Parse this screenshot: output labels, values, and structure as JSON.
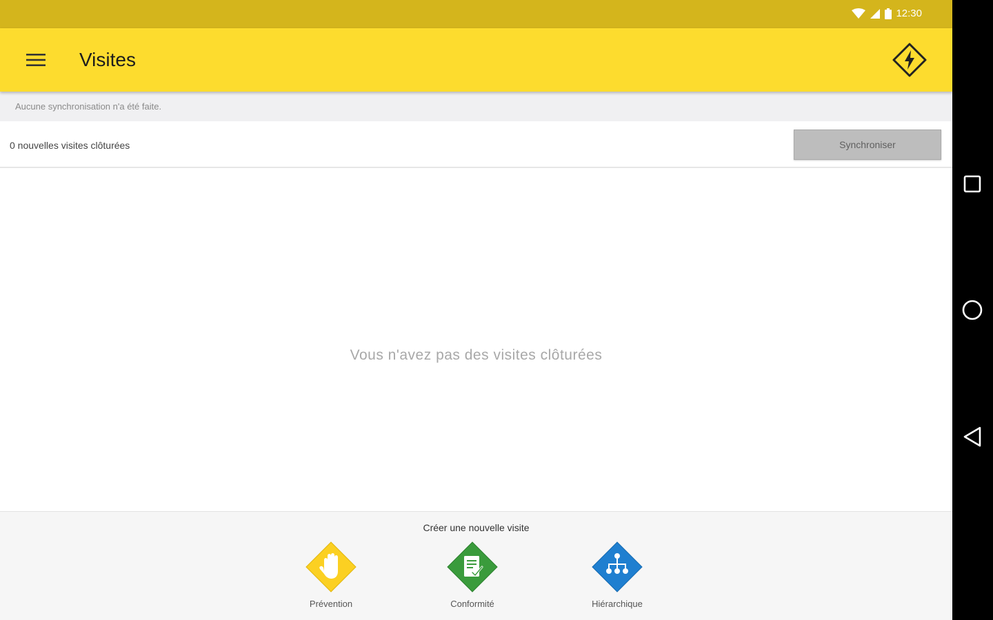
{
  "status_bar": {
    "time": "12:30"
  },
  "app_bar": {
    "title": "Visites"
  },
  "sync": {
    "info": "Aucune synchronisation n'a été faite.",
    "closed_count": "0 nouvelles visites clôturées",
    "button_label": "Synchroniser"
  },
  "empty_state": {
    "message": "Vous n'avez pas des visites clôturées"
  },
  "new_visit": {
    "heading": "Créer une nouvelle visite",
    "types": [
      {
        "label": "Prévention",
        "icon": "hand-icon",
        "color": "#fbd022"
      },
      {
        "label": "Conformité",
        "icon": "checklist-icon",
        "color": "#3a9b3c"
      },
      {
        "label": "Hiérarchique",
        "icon": "hierarchy-icon",
        "color": "#1f7fd0"
      }
    ]
  },
  "colors": {
    "status_bar": "#d4b51c",
    "app_bar": "#fddc2e"
  }
}
